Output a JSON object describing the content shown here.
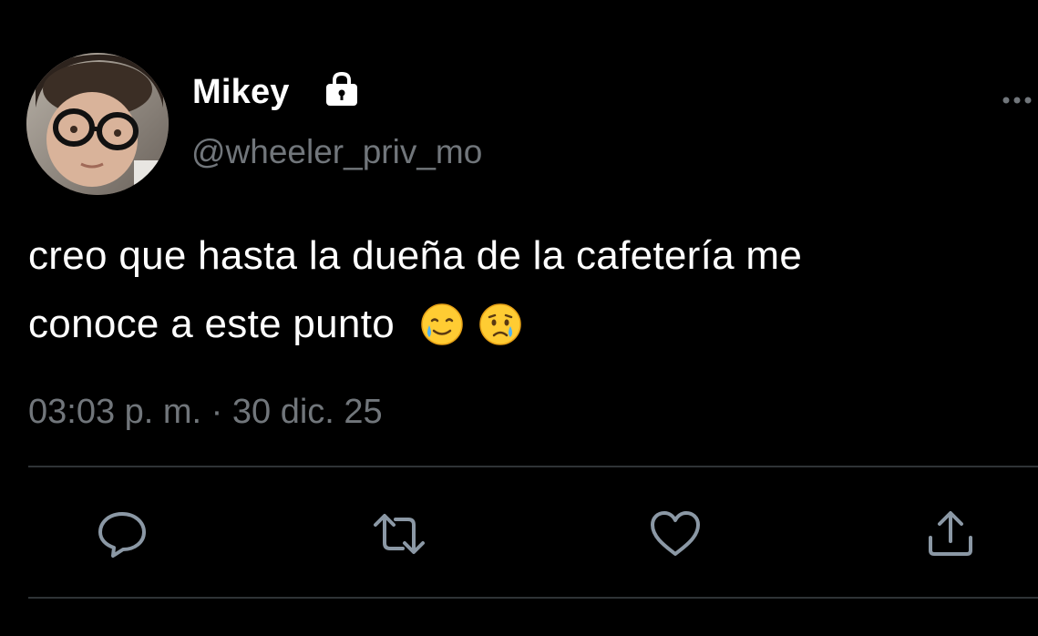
{
  "profile": {
    "display_name": "Mikey",
    "handle": "@wheeler_priv_mo",
    "protected_icon": "lock-icon",
    "avatar": "user-avatar-photo"
  },
  "tweet": {
    "text_line_1": "creo que hasta la dueña de la cafetería me",
    "text_line_2": "conoce a este punto",
    "emojis": [
      "smiling-face-with-tear",
      "crying-face"
    ],
    "timestamp": "03:03 p. m. · 30 dic. 25"
  },
  "actions": {
    "reply_icon": "reply-icon",
    "retweet_icon": "retweet-icon",
    "like_icon": "heart-icon",
    "share_icon": "share-icon"
  },
  "menu_icon": "more-icon",
  "colors": {
    "background": "#000000",
    "primary_text": "#ffffff",
    "secondary_text": "#71767b",
    "divider": "#2f3336",
    "action_icon": "#8b98a5"
  }
}
